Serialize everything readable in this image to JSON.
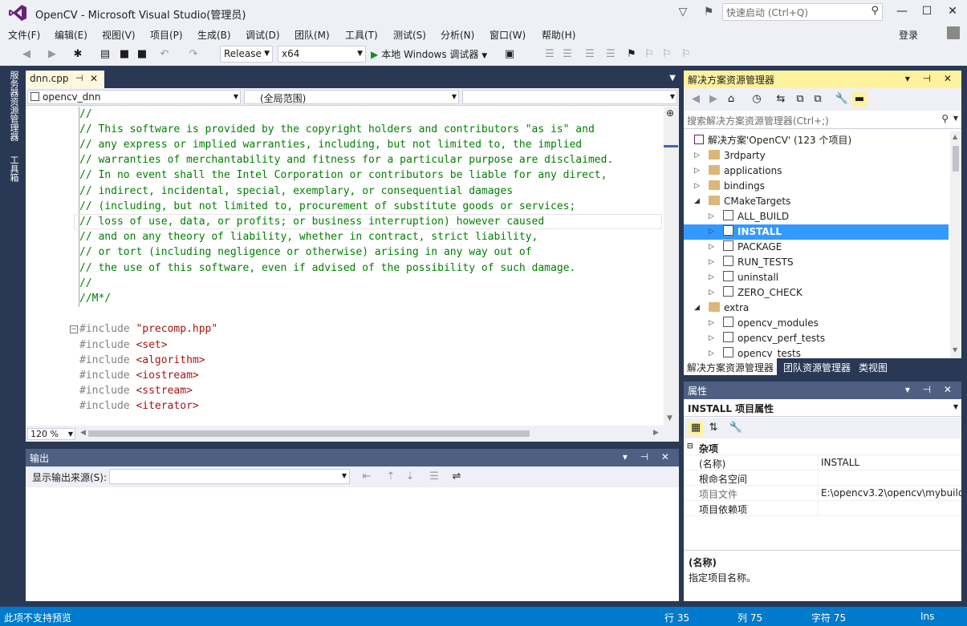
{
  "window": {
    "title": "OpenCV - Microsoft Visual Studio(管理员)",
    "quick_launch_placeholder": "快速启动 (Ctrl+Q)",
    "login": "登录"
  },
  "menu": [
    "文件(F)",
    "编辑(E)",
    "视图(V)",
    "项目(P)",
    "生成(B)",
    "调试(D)",
    "团队(M)",
    "工具(T)",
    "测试(S)",
    "分析(N)",
    "窗口(W)",
    "帮助(H)"
  ],
  "toolbar": {
    "config": "Release",
    "platform": "x64",
    "run": "本地 Windows 调试器"
  },
  "left_tabs": {
    "server": "服务器资源管理器",
    "toolbox": "工具箱"
  },
  "editor": {
    "tab": "dnn.cpp",
    "project_combo": "opencv_dnn",
    "scope_combo": "(全局范围)",
    "zoom": "120 %",
    "lines": [
      "//",
      "// This software is provided by the copyright holders and contributors \"as is\" and",
      "// any express or implied warranties, including, but not limited to, the implied",
      "// warranties of merchantability and fitness for a particular purpose are disclaimed.",
      "// In no event shall the Intel Corporation or contributors be liable for any direct,",
      "// indirect, incidental, special, exemplary, or consequential damages",
      "// (including, but not limited to, procurement of substitute goods or services;",
      "// loss of use, data, or profits; or business interruption) however caused",
      "// and on any theory of liability, whether in contract, strict liability,",
      "// or tort (including negligence or otherwise) arising in any way out of",
      "// the use of this software, even if advised of the possibility of such damage.",
      "//",
      "//M*/"
    ],
    "includes": [
      {
        "kw": "#include ",
        "arg": "\"precomp.hpp\""
      },
      {
        "kw": "#include ",
        "arg": "<set>"
      },
      {
        "kw": "#include ",
        "arg": "<algorithm>"
      },
      {
        "kw": "#include ",
        "arg": "<iostream>"
      },
      {
        "kw": "#include ",
        "arg": "<sstream>"
      },
      {
        "kw": "#include ",
        "arg": "<iterator>"
      }
    ]
  },
  "output": {
    "title": "输出",
    "source_label": "显示输出来源(S):"
  },
  "solution": {
    "title": "解决方案资源管理器",
    "search": "搜索解决方案资源管理器(Ctrl+;)",
    "root": "解决方案'OpenCV' (123 个项目)",
    "nodes": [
      {
        "label": "3rdparty",
        "kind": "folder",
        "level": 1,
        "exp": "▷"
      },
      {
        "label": "applications",
        "kind": "folder",
        "level": 1,
        "exp": "▷"
      },
      {
        "label": "bindings",
        "kind": "folder",
        "level": 1,
        "exp": "▷"
      },
      {
        "label": "CMakeTargets",
        "kind": "folder",
        "level": 1,
        "exp": "◢"
      },
      {
        "label": "ALL_BUILD",
        "kind": "proj",
        "level": 2,
        "exp": "▷"
      },
      {
        "label": "INSTALL",
        "kind": "proj",
        "level": 2,
        "exp": "▷",
        "selected": true
      },
      {
        "label": "PACKAGE",
        "kind": "proj",
        "level": 2,
        "exp": "▷"
      },
      {
        "label": "RUN_TESTS",
        "kind": "proj",
        "level": 2,
        "exp": "▷"
      },
      {
        "label": "uninstall",
        "kind": "proj",
        "level": 2,
        "exp": "▷"
      },
      {
        "label": "ZERO_CHECK",
        "kind": "proj",
        "level": 2,
        "exp": "▷"
      },
      {
        "label": "extra",
        "kind": "folder",
        "level": 1,
        "exp": "◢"
      },
      {
        "label": "opencv_modules",
        "kind": "proj",
        "level": 2,
        "exp": "▷"
      },
      {
        "label": "opencv_perf_tests",
        "kind": "proj",
        "level": 2,
        "exp": "▷"
      },
      {
        "label": "opencv_tests",
        "kind": "proj",
        "level": 2,
        "exp": "▷"
      }
    ],
    "tabs": [
      "解决方案资源管理器",
      "团队资源管理器",
      "类视图"
    ]
  },
  "properties": {
    "title": "属性",
    "selected": "INSTALL 项目属性",
    "category": "杂项",
    "rows": [
      {
        "k": "(名称)",
        "v": "INSTALL",
        "grey": false
      },
      {
        "k": "根命名空间",
        "v": "",
        "grey": false
      },
      {
        "k": "项目文件",
        "v": "E:\\opencv3.2\\opencv\\mybuild\\",
        "grey": true
      },
      {
        "k": "项目依赖项",
        "v": "",
        "grey": false
      }
    ],
    "desc_title": "(名称)",
    "desc_text": "指定项目名称。"
  },
  "status": {
    "msg": "此项不支持预览",
    "line": "行 35",
    "col": "列 75",
    "char": "字符 75",
    "mode": "Ins"
  },
  "colors": {
    "accent": "#007acc",
    "panel_header": "#4d6082",
    "active_tool": "#fff29d",
    "selection": "#3399ff",
    "comment": "#008000",
    "string": "#a31515"
  }
}
